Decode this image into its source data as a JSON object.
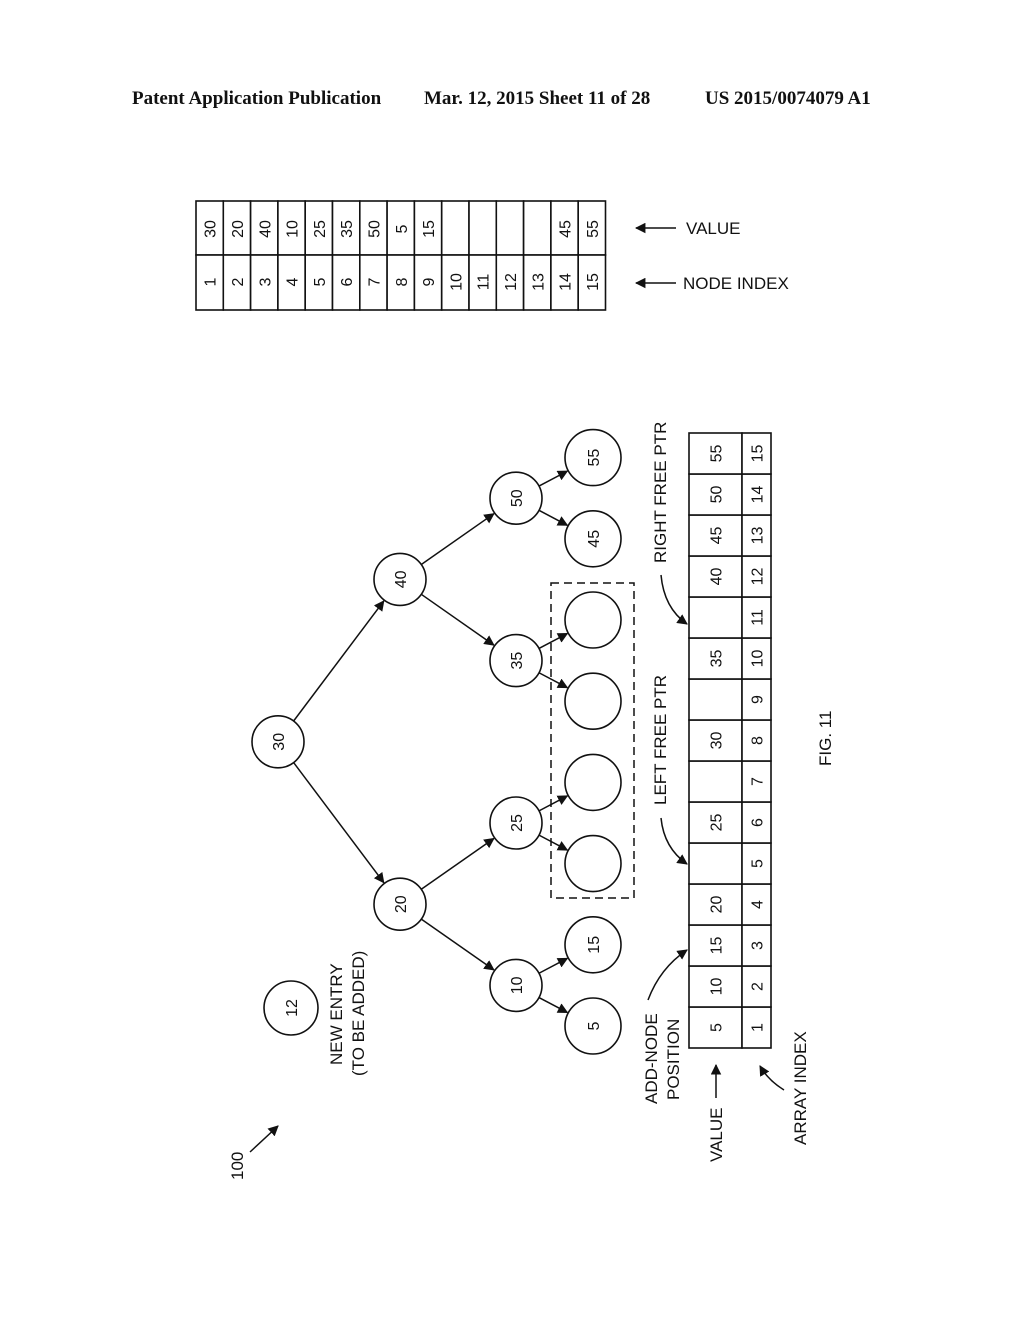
{
  "header": {
    "publication": "Patent Application Publication",
    "date_sheet": "Mar. 12, 2015  Sheet 11 of 28",
    "patent_number": "US 2015/0074079 A1"
  },
  "figure": {
    "label": "FIG. 11",
    "reference_numeral": "100",
    "new_entry": {
      "value": "12",
      "label_line1": "NEW ENTRY",
      "label_line2": "(TO BE ADDED)"
    }
  },
  "node_table": {
    "value_label": "VALUE",
    "index_label": "NODE INDEX",
    "values": [
      "30",
      "20",
      "40",
      "10",
      "25",
      "35",
      "50",
      "5",
      "15",
      "",
      "",
      "",
      "",
      "45",
      "55"
    ],
    "indices": [
      "1",
      "2",
      "3",
      "4",
      "5",
      "6",
      "7",
      "8",
      "9",
      "10",
      "11",
      "12",
      "13",
      "14",
      "15"
    ]
  },
  "tree": {
    "nodes": [
      {
        "id": "n30",
        "value": "30"
      },
      {
        "id": "n20",
        "value": "20"
      },
      {
        "id": "n40",
        "value": "40"
      },
      {
        "id": "n10",
        "value": "10"
      },
      {
        "id": "n25",
        "value": "25"
      },
      {
        "id": "n35",
        "value": "35"
      },
      {
        "id": "n50",
        "value": "50"
      },
      {
        "id": "n5",
        "value": "5"
      },
      {
        "id": "n15",
        "value": "15"
      },
      {
        "id": "e1",
        "value": ""
      },
      {
        "id": "e2",
        "value": ""
      },
      {
        "id": "e3",
        "value": ""
      },
      {
        "id": "e4",
        "value": ""
      },
      {
        "id": "n45",
        "value": "45"
      },
      {
        "id": "n55",
        "value": "55"
      }
    ],
    "edges": [
      [
        "n30",
        "n20"
      ],
      [
        "n30",
        "n40"
      ],
      [
        "n20",
        "n10"
      ],
      [
        "n20",
        "n25"
      ],
      [
        "n40",
        "n35"
      ],
      [
        "n40",
        "n50"
      ],
      [
        "n10",
        "n5"
      ],
      [
        "n10",
        "n15"
      ],
      [
        "n25",
        "e1"
      ],
      [
        "n25",
        "e2"
      ],
      [
        "n35",
        "e3"
      ],
      [
        "n35",
        "e4"
      ],
      [
        "n50",
        "n45"
      ],
      [
        "n50",
        "n55"
      ]
    ],
    "empty_group": [
      "e1",
      "e2",
      "e3",
      "e4"
    ]
  },
  "array_table": {
    "value_label": "VALUE",
    "index_label": "ARRAY INDEX",
    "add_node_label_line1": "ADD-NODE",
    "add_node_label_line2": "POSITION",
    "left_free_ptr_label": "LEFT FREE PTR",
    "right_free_ptr_label": "RIGHT FREE PTR",
    "values": [
      "5",
      "10",
      "15",
      "20",
      "",
      "25",
      "",
      "30",
      "",
      "35",
      "",
      "40",
      "45",
      "50",
      "55"
    ],
    "indices": [
      "1",
      "2",
      "3",
      "4",
      "5",
      "6",
      "7",
      "8",
      "9",
      "10",
      "11",
      "12",
      "13",
      "14",
      "15"
    ],
    "add_node_position_index": 3,
    "left_free_ptr_index": 5,
    "right_free_ptr_index": 11
  }
}
